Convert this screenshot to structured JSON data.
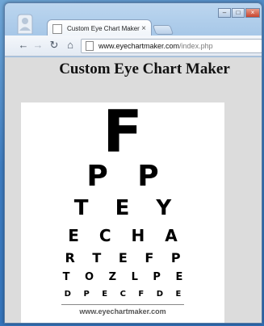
{
  "browser": {
    "tab_title": "Custom Eye Chart Maker",
    "tab_close": "×",
    "url_host": "www.eyechartmaker.com",
    "url_path": "/index.php",
    "nav": {
      "back": "←",
      "forward": "→",
      "reload": "↻",
      "home": "⌂"
    },
    "window_controls": [
      "–",
      "□",
      "×"
    ]
  },
  "page": {
    "title": "Custom Eye Chart Maker"
  },
  "eye_chart": {
    "rows": [
      "F",
      "P P",
      "T E Y",
      "E C H A",
      "R T E F P",
      "T O Z L P E",
      "D P E C F D E"
    ],
    "footer": "www.eyechartmaker.com"
  },
  "colors": {
    "content_background": "#dcdcdc",
    "chart_background": "#ffffff",
    "letters": "#000000"
  },
  "icons": [
    "profile-icon",
    "favicon-icon",
    "page-icon",
    "back-icon",
    "forward-icon",
    "reload-icon",
    "home-icon"
  ]
}
